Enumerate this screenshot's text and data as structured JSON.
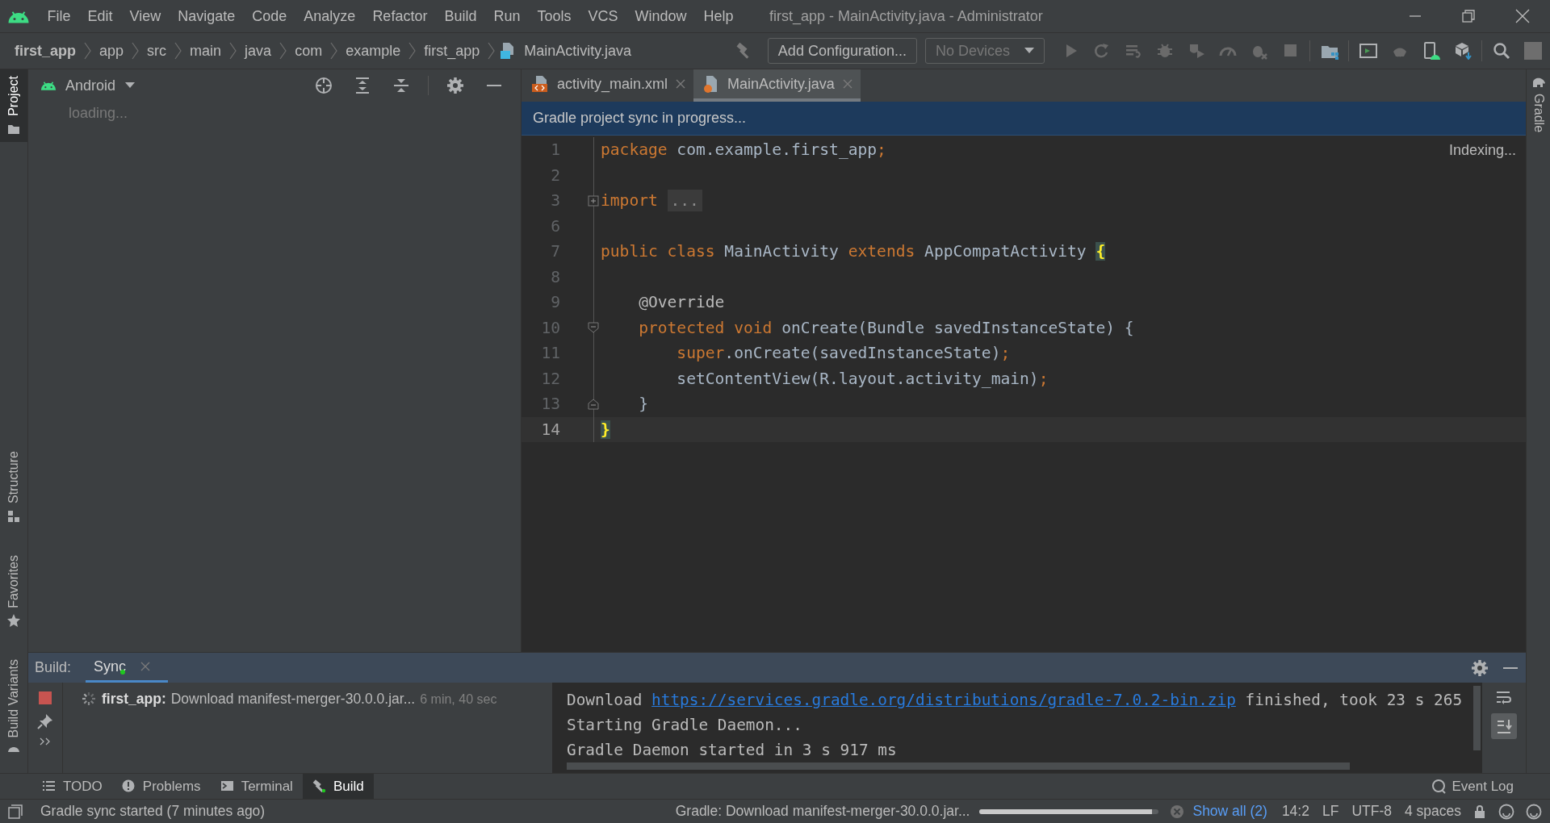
{
  "title_bar": {
    "menus": [
      "File",
      "Edit",
      "View",
      "Navigate",
      "Code",
      "Analyze",
      "Refactor",
      "Build",
      "Run",
      "Tools",
      "VCS",
      "Window",
      "Help"
    ],
    "title": "first_app - MainActivity.java - Administrator"
  },
  "breadcrumbs": [
    "first_app",
    "app",
    "src",
    "main",
    "java",
    "com",
    "example",
    "first_app",
    "MainActivity.java"
  ],
  "toolbar": {
    "configuration": "Add Configuration...",
    "device": {
      "label": "No Devices",
      "disabled": true
    }
  },
  "left_strip": [
    {
      "label": "Project",
      "selected": true
    },
    {
      "label": "Structure",
      "selected": false
    },
    {
      "label": "Favorites",
      "selected": false
    },
    {
      "label": "Build Variants",
      "selected": false
    }
  ],
  "right_strip": [
    {
      "label": "Gradle",
      "selected": false
    }
  ],
  "project_panel": {
    "view": "Android",
    "status": "loading..."
  },
  "editor_tabs": [
    {
      "label": "activity_main.xml",
      "kind": "xml",
      "selected": false
    },
    {
      "label": "MainActivity.java",
      "kind": "java",
      "selected": true
    }
  ],
  "banner": "Gradle project sync in progress...",
  "indexing": "Indexing...",
  "code_lines": [
    {
      "number": "1",
      "kind": "code",
      "current": false,
      "tokens": [
        {
          "text": "package",
          "kind": "keyword"
        },
        {
          "text": " com.example.first_app",
          "kind": "plain"
        },
        {
          "text": ";",
          "kind": "punct"
        }
      ]
    },
    {
      "number": "2",
      "kind": "code",
      "current": false
    },
    {
      "number": "3",
      "kind": "fold-collapsed",
      "current": false,
      "tokens": [
        {
          "text": "import",
          "kind": "keyword"
        },
        {
          "text": "...",
          "kind": "folded"
        }
      ]
    },
    {
      "number": "6",
      "kind": "code",
      "current": false
    },
    {
      "number": "7",
      "kind": "code",
      "current": false,
      "tokens": [
        {
          "text": "public class",
          "kind": "keyword"
        },
        {
          "text": " MainActivity ",
          "kind": "plain"
        },
        {
          "text": "extends",
          "kind": "keyword"
        },
        {
          "text": " AppCompatActivity ",
          "kind": "plain"
        },
        {
          "text": "{",
          "kind": "brace-match"
        }
      ]
    },
    {
      "number": "8",
      "kind": "code",
      "current": false
    },
    {
      "number": "9",
      "kind": "code",
      "current": false,
      "tokens": [
        {
          "text": "    @Override",
          "kind": "annotation"
        }
      ]
    },
    {
      "number": "10",
      "kind": "fold-start",
      "current": false,
      "tokens": [
        {
          "text": "    protected void",
          "kind": "keyword"
        },
        {
          "text": " onCreate(Bundle savedInstanceState) {",
          "kind": "plain"
        }
      ]
    },
    {
      "number": "11",
      "kind": "code",
      "current": false,
      "tokens": [
        {
          "text": "        super",
          "kind": "keyword"
        },
        {
          "text": ".onCreate(savedInstanceState)",
          "kind": "plain"
        },
        {
          "text": ";",
          "kind": "punct"
        }
      ]
    },
    {
      "number": "12",
      "kind": "code",
      "current": false,
      "tokens": [
        {
          "text": "        setContentView(R.layout.activity_main)",
          "kind": "plain"
        },
        {
          "text": ";",
          "kind": "punct"
        }
      ]
    },
    {
      "number": "13",
      "kind": "fold-end",
      "current": false,
      "tokens": [
        {
          "text": "    }",
          "kind": "plain"
        }
      ]
    },
    {
      "number": "14",
      "kind": "code",
      "current": true,
      "tokens": [
        {
          "text": "}",
          "kind": "brace-match"
        }
      ]
    }
  ],
  "build_panel": {
    "label": "Build:",
    "tabs": [
      {
        "label": "Sync",
        "selected": true
      }
    ],
    "task": {
      "name": "first_app:",
      "message": "Download manifest-merger-30.0.0.jar...",
      "time": "6 min, 40 sec"
    },
    "console": [
      {
        "segments": [
          {
            "text": "Download ",
            "kind": "plain"
          },
          {
            "text": "https://services.gradle.org/distributions/gradle-7.0.2-bin.zip",
            "kind": "link"
          },
          {
            "text": " finished, took 23 s 265",
            "kind": "plain"
          }
        ]
      },
      {
        "segments": [
          {
            "text": "Starting Gradle Daemon...",
            "kind": "plain"
          }
        ]
      },
      {
        "segments": [
          {
            "text": "Gradle Daemon started in 3 s 917 ms",
            "kind": "plain"
          }
        ]
      }
    ]
  },
  "tool_tabs": [
    {
      "label": "TODO",
      "selected": false
    },
    {
      "label": "Problems",
      "selected": false
    },
    {
      "label": "Terminal",
      "selected": false
    },
    {
      "label": "Build",
      "selected": true
    }
  ],
  "event_log": "Event Log",
  "status_bar": {
    "message": "Gradle sync started (7 minutes ago)",
    "progress_text": "Gradle: Download manifest-merger-30.0.0.jar...",
    "progress": {
      "level": 0.96
    },
    "show_all": "Show all (2)",
    "position": "14:2",
    "line_separator": "LF",
    "encoding": "UTF-8",
    "indent": "4 spaces"
  }
}
